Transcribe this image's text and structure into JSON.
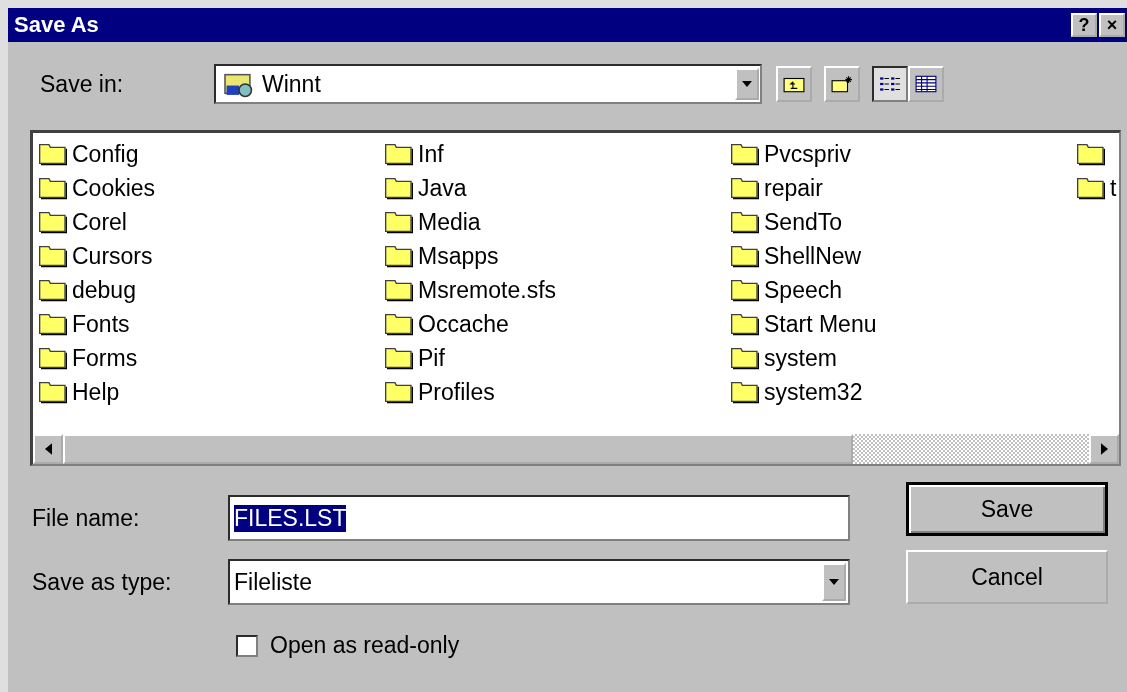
{
  "window": {
    "title": "Save As",
    "buttons": [
      "?",
      "×"
    ]
  },
  "save_in": {
    "label": "Save in:",
    "value": "Winnt"
  },
  "toolbar": [
    {
      "kind": "up"
    },
    {
      "kind": "new-folder"
    },
    {
      "kind": "list",
      "selected": true
    },
    {
      "kind": "details",
      "selected": false
    }
  ],
  "files": {
    "columns": [
      [
        {
          "name": "Config"
        },
        {
          "name": "Cookies"
        },
        {
          "name": "Corel"
        },
        {
          "name": "Cursors"
        },
        {
          "name": "debug"
        },
        {
          "name": "Fonts"
        },
        {
          "name": "Forms"
        },
        {
          "name": "Help"
        }
      ],
      [
        {
          "name": "Inf"
        },
        {
          "name": "Java"
        },
        {
          "name": "Media"
        },
        {
          "name": "Msapps"
        },
        {
          "name": "Msremote.sfs"
        },
        {
          "name": "Occache"
        },
        {
          "name": "Pif"
        },
        {
          "name": "Profiles"
        }
      ],
      [
        {
          "name": "Pvcspriv"
        },
        {
          "name": "repair"
        },
        {
          "name": "SendTo"
        },
        {
          "name": "ShellNew"
        },
        {
          "name": "Speech"
        },
        {
          "name": "Start Menu"
        },
        {
          "name": "system"
        },
        {
          "name": "system32"
        }
      ],
      [
        {},
        {
          "name": "t"
        }
      ]
    ]
  },
  "file_name": {
    "label": "File name:",
    "value": "FILES.LST"
  },
  "save_as_type": {
    "label": "Save as type:",
    "value": "Fileliste"
  },
  "read_only": {
    "label": "Open as read-only",
    "checked": false
  },
  "buttons": [
    {
      "label": "Save",
      "default": true
    },
    {
      "label": "Cancel",
      "default": false
    }
  ]
}
